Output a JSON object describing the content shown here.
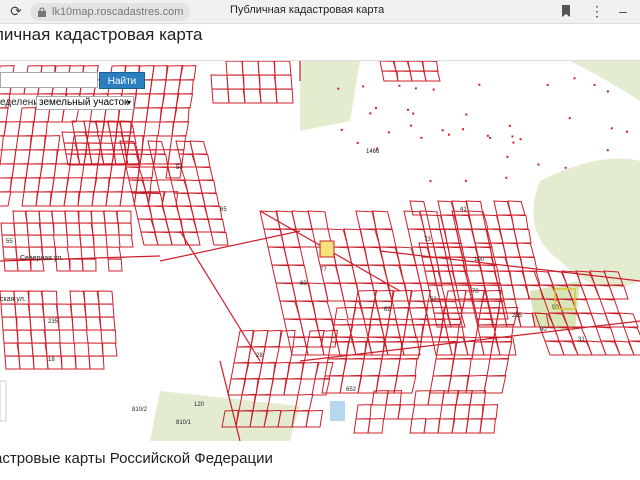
{
  "browser": {
    "url": "lk10map.roscadastres.com",
    "tab_title": "Публичная кадастровая карта"
  },
  "page": {
    "title": "личная кадастровая карта",
    "footer": "астровые карты Российской Федерации"
  },
  "search": {
    "button_label": "Найти",
    "filter_label": "еделение",
    "filter_value": "земельный участок"
  },
  "map_labels": [
    "1466",
    "225",
    "810/2",
    "810/1",
    "Северная ул.",
    "ская ул.",
    "235",
    "55",
    "65",
    "120",
    "28",
    "73",
    "80",
    "90",
    "60",
    "100",
    "31",
    "41",
    "56",
    "70",
    "652",
    "52",
    "18",
    "77",
    "62"
  ],
  "colors": {
    "parcel_line": "#cc1f2a",
    "green_area": "#dde8c5",
    "search_button": "#2a7fc0",
    "water": "#b7d7ef"
  }
}
